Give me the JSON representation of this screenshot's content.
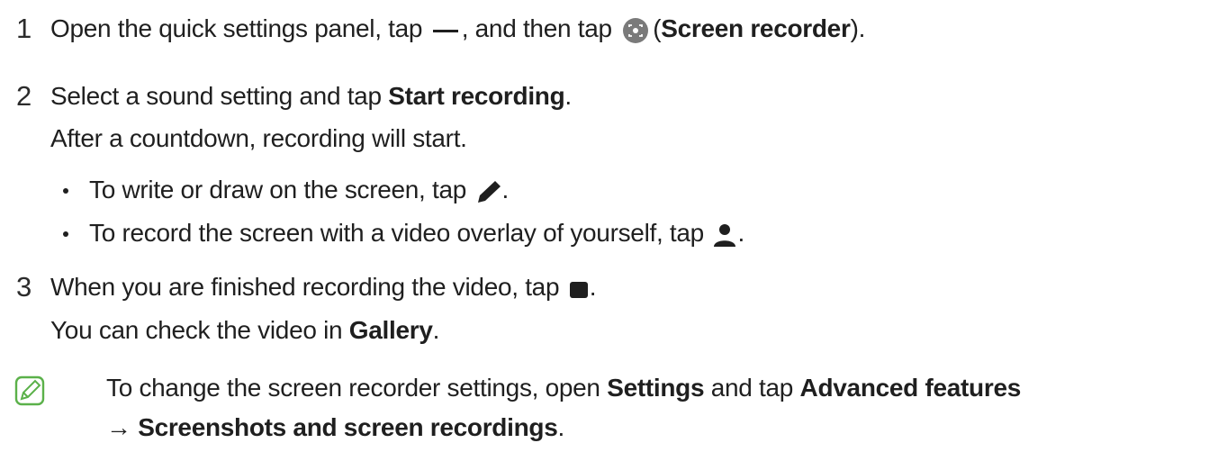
{
  "steps": [
    {
      "number": "1",
      "text_before": "Open the quick settings panel, tap",
      "text_middle": ", and then tap",
      "bold_open": "(",
      "bold_label": "Screen recorder",
      "bold_close": ").",
      "icons": [
        "more-options-dash-icon",
        "screen-recorder-icon"
      ]
    },
    {
      "number": "2",
      "text_before": "Select a sound setting and tap",
      "bold_label": "Start recording",
      "text_after": ".",
      "subtext": "After a countdown, recording will start.",
      "bullets": [
        {
          "text": "To write or draw on the screen, tap",
          "end": ".",
          "icon": "pen-icon"
        },
        {
          "text": "To record the screen with a video overlay of yourself, tap",
          "end": ".",
          "icon": "person-icon"
        }
      ]
    },
    {
      "number": "3",
      "text_before": "When you are finished recording the video, tap",
      "text_after": ".",
      "icon": "stop-icon",
      "subtext_before": "You can check the video in",
      "subtext_bold": "Gallery",
      "subtext_after": "."
    }
  ],
  "note": {
    "icon": "note-icon",
    "accent_color": "#5bb14a",
    "line1_before": "To change the screen recorder settings, open",
    "line1_bold1": "Settings",
    "line1_mid": "and tap",
    "line1_bold2": "Advanced features",
    "arrow": "→",
    "line2_bold": "Screenshots and screen recordings",
    "line2_after": "."
  }
}
